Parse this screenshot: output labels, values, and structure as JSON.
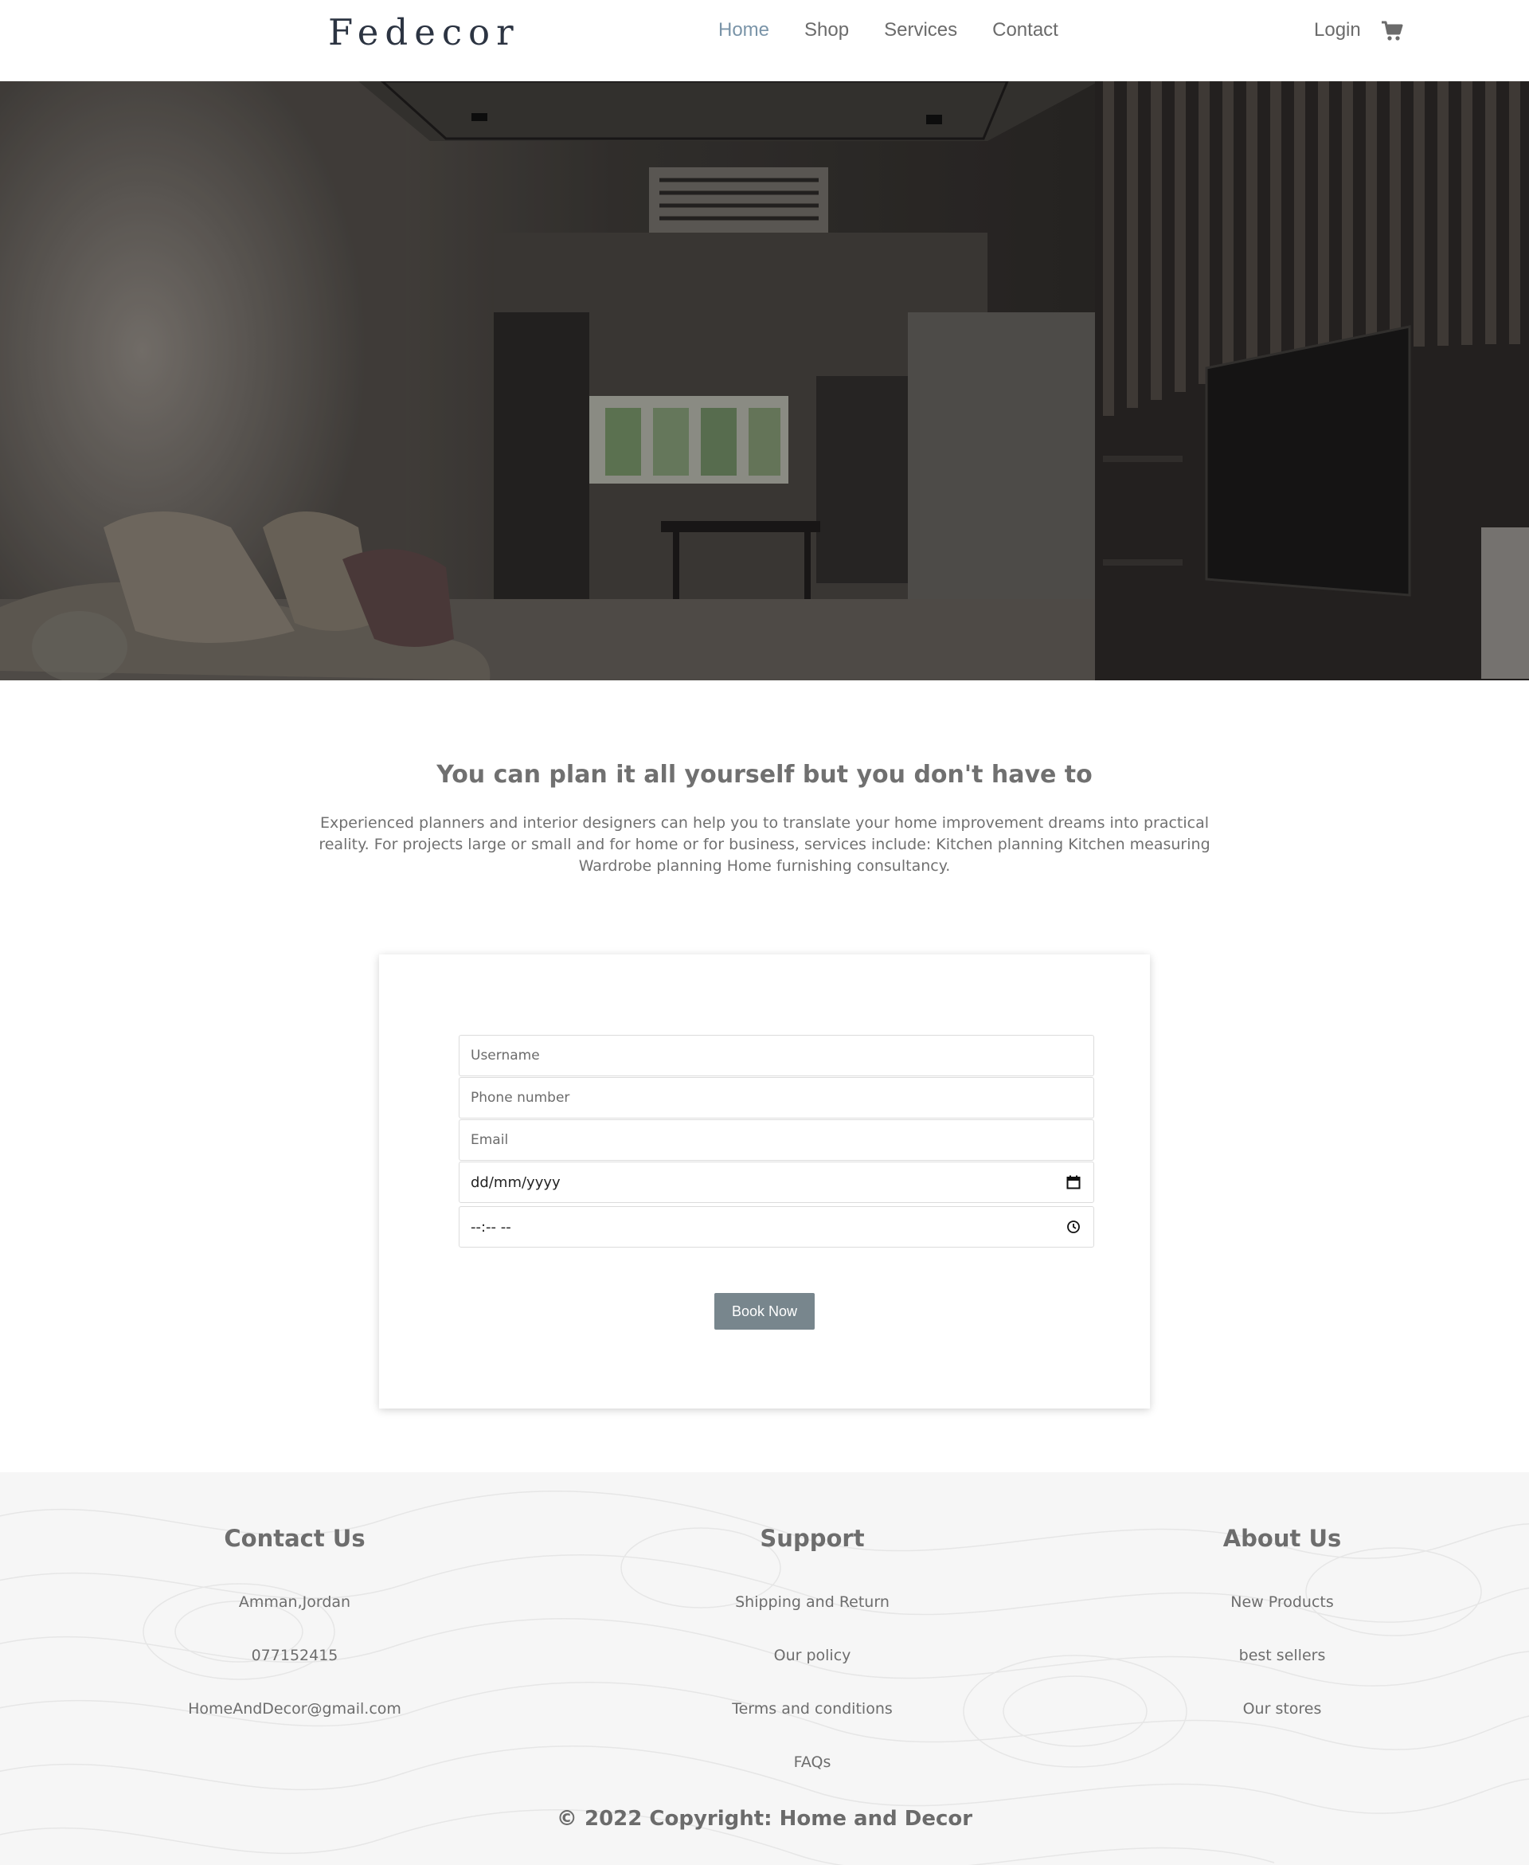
{
  "header": {
    "logo": "Fedecor",
    "nav": [
      "Home",
      "Shop",
      "Services",
      "Contact"
    ],
    "active_nav": "Home",
    "login_label": "Login",
    "cart_icon": "cart-icon"
  },
  "intro": {
    "title": "You can plan it all yourself but you don't have to",
    "text": "Experienced planners and interior designers can help you to translate your home improvement dreams into practical reality. For projects large or small and for home or for business, services include: Kitchen planning Kitchen measuring Wardrobe planning Home furnishing consultancy."
  },
  "form": {
    "username_placeholder": "Username",
    "phone_placeholder": "Phone number",
    "email_placeholder": "Email",
    "date_value": "dd/mm/yyyy",
    "time_value": "--:-- --",
    "submit_label": "Book Now"
  },
  "footer": {
    "contact": {
      "title": "Contact Us",
      "items": [
        "Amman,Jordan",
        "077152415",
        "HomeAndDecor@gmail.com"
      ]
    },
    "support": {
      "title": "Support",
      "items": [
        "Shipping and Return",
        "Our policy",
        "Terms and conditions",
        "FAQs"
      ]
    },
    "about": {
      "title": "About Us",
      "items": [
        "New Products",
        "best sellers",
        "Our stores"
      ]
    },
    "copyright": "© 2022 Copyright: Home and Decor"
  },
  "colors": {
    "accent_nav": "#7a94a8",
    "button": "#78868d",
    "text": "#6b6b6b"
  }
}
